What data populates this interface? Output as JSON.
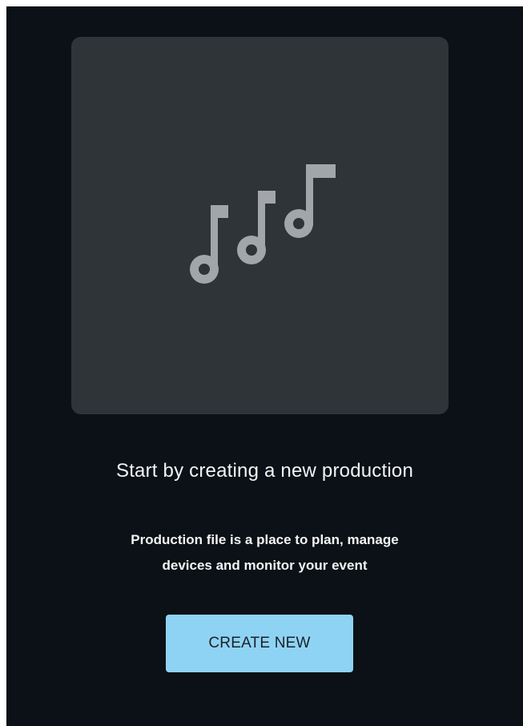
{
  "empty_state": {
    "illustration": {
      "icon": "music-notes-icon",
      "background_color": "#2e3437",
      "icon_color": "#a3a6a8"
    },
    "title": "Start by creating a new production",
    "description_line_1": "Production file is a place to plan, manage",
    "description_line_2": "devices and monitor your event",
    "create_button_label": "CREATE NEW",
    "colors": {
      "page_background": "#0b1116",
      "button_background": "#8fd3f4",
      "button_text": "#1a2126",
      "text": "#f2f4f5"
    }
  }
}
